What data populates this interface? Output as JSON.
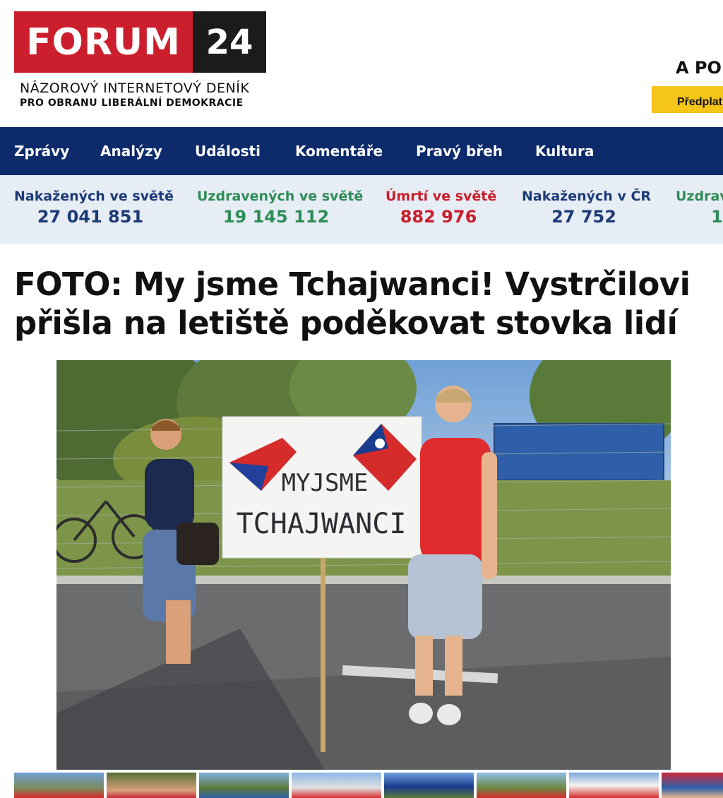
{
  "brand": {
    "logo_word": "FORUM",
    "logo_number": "24",
    "tagline_1": "NÁZOROVÝ INTERNETOVÝ DENÍK",
    "tagline_2": "PRO OBRANU LIBERÁLNÍ DEMOKRACIE",
    "brand_red": "#cc1f2d",
    "brand_dark": "#1b1b1b"
  },
  "promo": {
    "text": "A PO",
    "button_label": "Předplat"
  },
  "nav": {
    "items": [
      "Zprávy",
      "Analýzy",
      "Události",
      "Komentáře",
      "Pravý břeh",
      "Kultura"
    ],
    "background": "#0d2b6b"
  },
  "stats": [
    {
      "label": "Nakažených ve světě",
      "value": "27 041 851",
      "color": "#1c3b76"
    },
    {
      "label": "Uzdravených ve světě",
      "value": "19 145 112",
      "color": "#2f8c57"
    },
    {
      "label": "Úmrtí ve světě",
      "value": "882 976",
      "color": "#c91e2b"
    },
    {
      "label": "Nakažených v ČR",
      "value": "27 752",
      "color": "#1c3b76"
    },
    {
      "label": "Uzdrav",
      "value": "1",
      "color": "#2f8c57"
    }
  ],
  "article": {
    "title": "FOTO: My jsme Tchajwanci! Vystrčilovi přišla na letiště poděkovat stovka lidí",
    "sign_line_1": "MYJSME",
    "sign_line_2": "TCHAJWANCI"
  }
}
